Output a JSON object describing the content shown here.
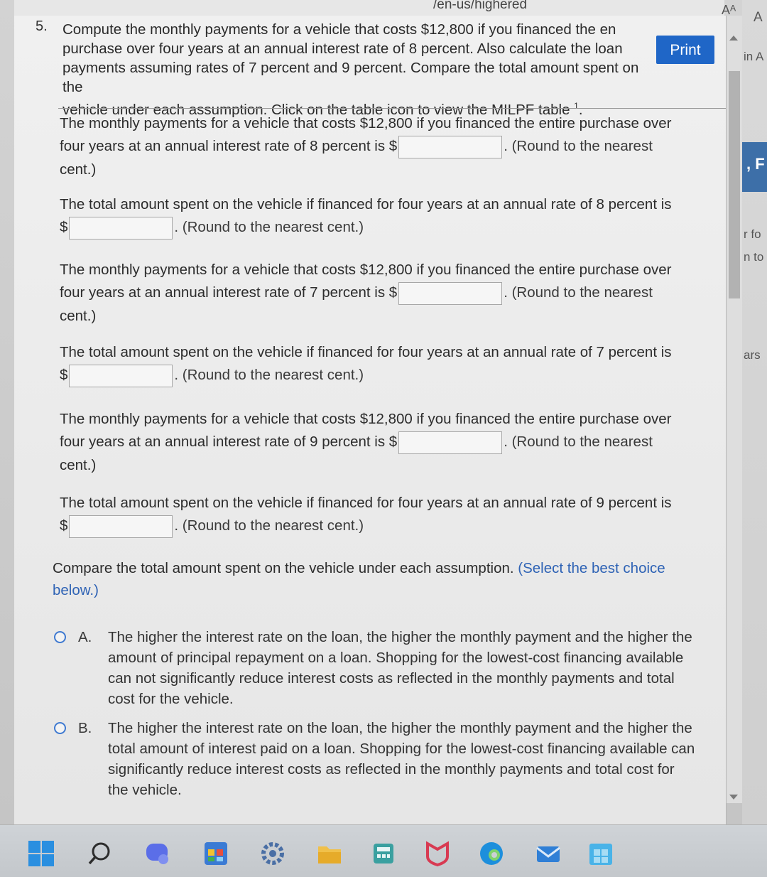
{
  "browser": {
    "url_fragment": "/en-us/highered",
    "font_button_label": "Aᴬ"
  },
  "question": {
    "number": "5.",
    "prompt": "Compute the monthly payments for a vehicle that costs $12,800 if you financed the en",
    "prompt_line2": "purchase over four years at an annual interest rate of 8 percent. Also calculate the loan",
    "prompt_line3": "payments assuming rates of 7 percent and 9 percent. Compare the total amount spent on the",
    "prompt_line4": "vehicle under each assumption. Click on the table icon to view the MILPF table",
    "footnote_marker": "1",
    "print_label": "Print"
  },
  "parts": [
    {
      "line1": "The monthly payments for a vehicle that costs $12,800 if you financed the entire purchase over",
      "line2_pre": "four years at an annual interest rate of 8 percent is $",
      "line2_post": ". (Round to the nearest",
      "line3": "cent.)"
    },
    {
      "line1": "The total amount spent on the vehicle if financed for four years at an annual rate of 8 percent is",
      "currency": "$",
      "post": ". (Round to the nearest cent.)"
    },
    {
      "line1": "The monthly payments for a vehicle that costs $12,800 if you financed the entire purchase over",
      "line2_pre": "four years at an annual interest rate of 7 percent is $",
      "line2_post": ". (Round to the nearest",
      "line3": "cent.)"
    },
    {
      "line1": "The total amount spent on the vehicle if financed for four years at an annual rate of 7 percent is",
      "currency": "$",
      "post": ". (Round to the nearest cent.)"
    },
    {
      "line1": "The monthly payments for a vehicle that costs $12,800 if you financed the entire purchase over",
      "line2_pre": "four years at an annual interest rate of 9 percent is $",
      "line2_post": ". (Round to the nearest",
      "line3": "cent.)"
    },
    {
      "line1": "The total amount spent on the vehicle if financed for four years at an annual rate of 9 percent is",
      "currency": "$",
      "post": ". (Round to the nearest cent.)"
    }
  ],
  "compare": {
    "text": "Compare the total amount spent on the vehicle under each assumption.",
    "hint": "(Select the best choice below.)"
  },
  "choices": [
    {
      "letter": "A.",
      "text": "The higher the interest rate on the loan, the higher the monthly payment and the higher the amount of principal repayment on a loan. Shopping for the lowest-cost financing available can not significantly reduce interest costs as reflected in the monthly payments and total cost for the vehicle."
    },
    {
      "letter": "B.",
      "text": "The higher the interest rate on the loan, the higher the monthly payment and the higher the total amount of interest paid on a loan. Shopping for the lowest-cost financing available can significantly reduce interest costs as reflected in the monthly payments and total cost for the vehicle."
    }
  ],
  "background_window": {
    "fragments": [
      "A",
      "in A",
      ", F",
      "r fo",
      "n to",
      "ars"
    ]
  },
  "colors": {
    "print_button": "#1f66c7",
    "hint_text": "#2f63b5",
    "radio_border": "#3f7ad1"
  }
}
